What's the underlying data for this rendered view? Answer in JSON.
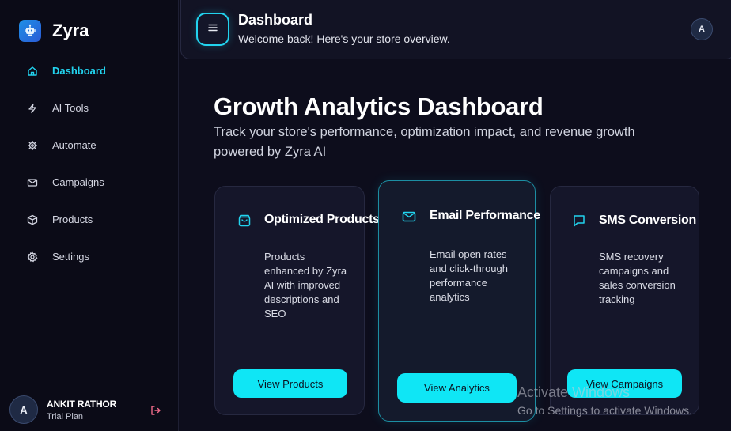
{
  "brand": {
    "name": "Zyra",
    "logo_icon": "robot-icon"
  },
  "sidebar": {
    "items": [
      {
        "label": "Dashboard",
        "icon": "home-icon",
        "active": true
      },
      {
        "label": "AI Tools",
        "icon": "lightning-icon",
        "active": false
      },
      {
        "label": "Automate",
        "icon": "cog-icon",
        "active": false
      },
      {
        "label": "Campaigns",
        "icon": "mail-icon",
        "active": false
      },
      {
        "label": "Products",
        "icon": "box-icon",
        "active": false
      },
      {
        "label": "Settings",
        "icon": "gear-icon",
        "active": false
      }
    ],
    "user": {
      "initial": "A",
      "name": "ANKIT RATHOR",
      "plan": "Trial Plan",
      "logout_icon": "logout-icon"
    }
  },
  "header": {
    "title": "Dashboard",
    "subtitle": "Welcome back! Here's your store overview.",
    "avatar_initial": "A",
    "menu_icon": "menu-icon"
  },
  "main": {
    "title": "Growth Analytics Dashboard",
    "description": "Track your store's performance, optimization impact, and revenue growth powered by Zyra AI"
  },
  "cards": [
    {
      "icon": "shopping-bag-icon",
      "title": "Optimized Products",
      "text": "Products enhanced by Zyra AI with improved descriptions and SEO",
      "button": "View Products"
    },
    {
      "icon": "mail-icon",
      "title": "Email Performance",
      "text": "Email open rates and click-through performance analytics",
      "button": "View Analytics"
    },
    {
      "icon": "chat-icon",
      "title": "SMS Conversion",
      "text": "SMS recovery campaigns and sales conversion tracking",
      "button": "View Campaigns"
    }
  ],
  "watermark": {
    "title": "Activate Windows",
    "subtitle": "Go to Settings to activate Windows."
  },
  "colors": {
    "accent": "#22d3ee",
    "button": "#0fe6f5",
    "background": "#0d0d1c"
  }
}
